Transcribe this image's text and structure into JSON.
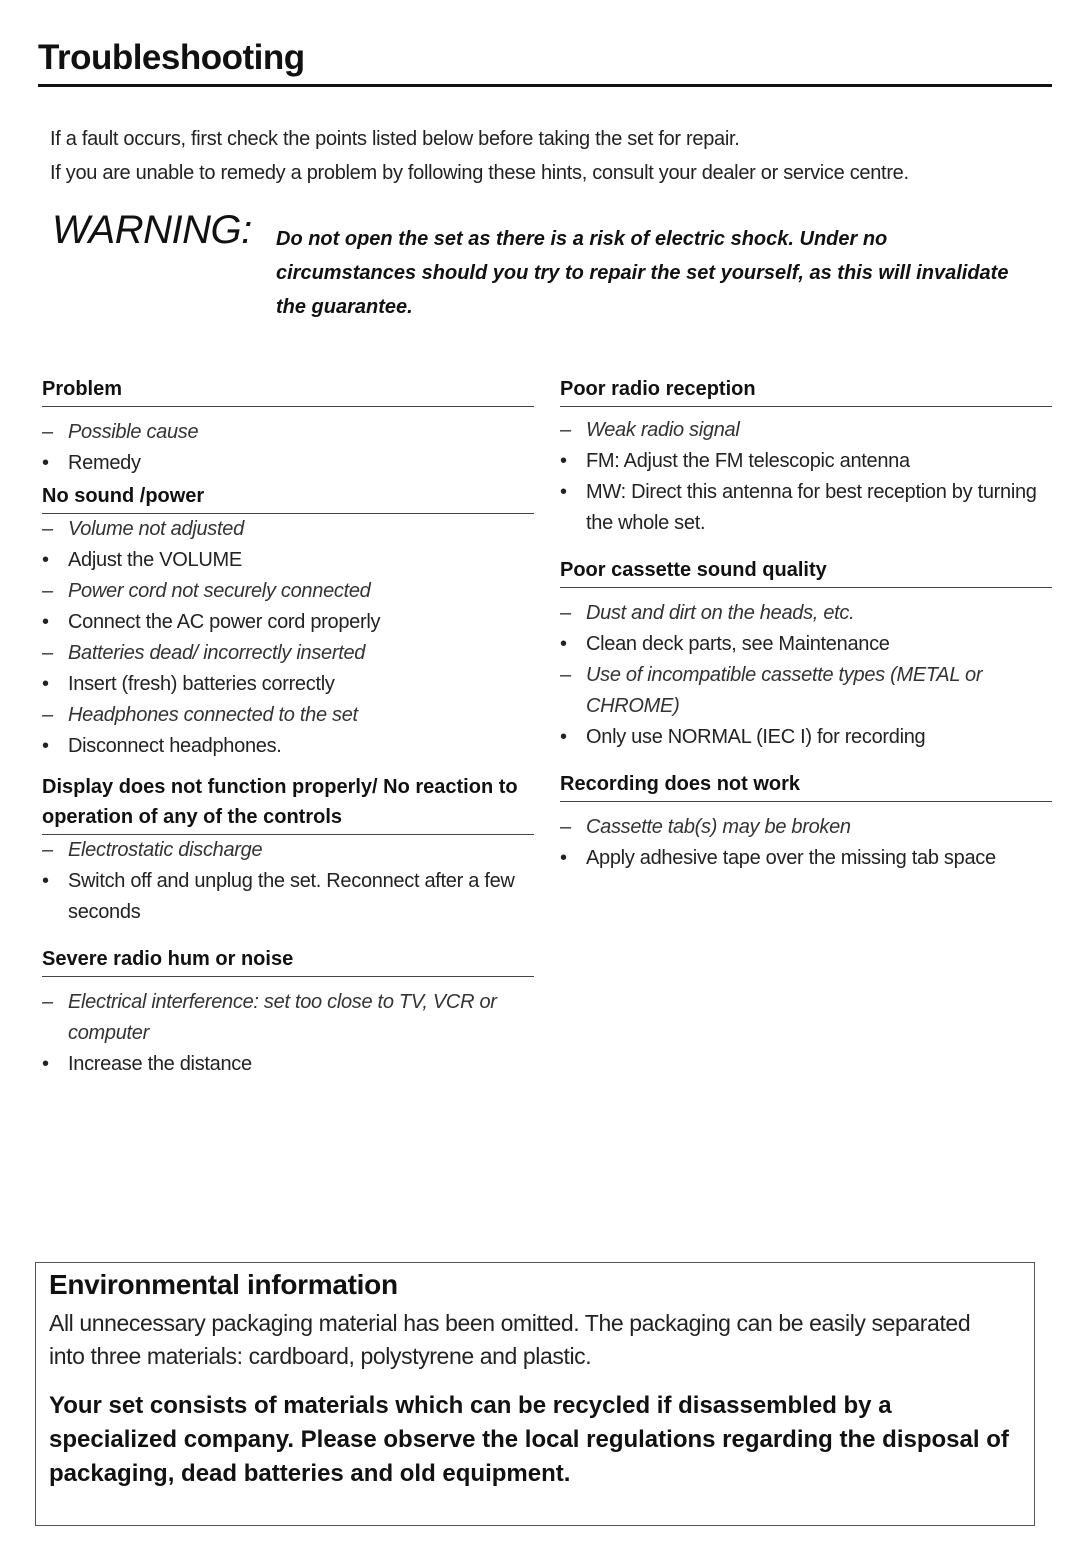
{
  "title": "Troubleshooting",
  "intro": [
    "If a fault occurs, first check the points listed below before taking the set for repair.",
    "If you are unable to remedy a problem by following these hints, consult your dealer or service centre."
  ],
  "warning": {
    "label": "WARNING:",
    "text": "Do not open the set as there is a risk of electric shock. Under no circumstances should you try to repair the set yourself, as this will invalidate the guarantee."
  },
  "icons": {
    "cause": "–",
    "remedy": "•"
  },
  "left_sections": [
    {
      "heading": "Problem",
      "items": [
        {
          "type": "cause",
          "text": "Possible cause"
        },
        {
          "type": "remedy",
          "text": "Remedy"
        }
      ]
    },
    {
      "heading": "No sound /power",
      "items": [
        {
          "type": "cause",
          "text": "Volume not adjusted"
        },
        {
          "type": "remedy",
          "text": "Adjust the VOLUME"
        },
        {
          "type": "cause",
          "text": "Power cord not securely connected"
        },
        {
          "type": "remedy",
          "text": "Connect the AC power cord properly"
        },
        {
          "type": "cause",
          "text": "Batteries dead/ incorrectly inserted"
        },
        {
          "type": "remedy",
          "text": "Insert (fresh) batteries correctly"
        },
        {
          "type": "cause",
          "text": "Headphones connected to the set"
        },
        {
          "type": "remedy",
          "text": "Disconnect headphones."
        }
      ]
    },
    {
      "heading": "Display does not function properly/ No reaction to operation of any of the controls",
      "items": [
        {
          "type": "cause",
          "text": "Electrostatic discharge"
        },
        {
          "type": "remedy",
          "text": "Switch off and unplug the set. Reconnect after a few seconds"
        }
      ]
    },
    {
      "heading": "Severe radio hum or noise",
      "items": [
        {
          "type": "cause",
          "text": "Electrical interference: set too close to TV, VCR or computer"
        },
        {
          "type": "remedy",
          "text": "Increase the distance"
        }
      ]
    }
  ],
  "right_sections": [
    {
      "heading": "Poor radio reception",
      "items": [
        {
          "type": "cause",
          "text": "Weak radio signal"
        },
        {
          "type": "remedy",
          "text": "FM: Adjust the FM telescopic antenna"
        },
        {
          "type": "remedy",
          "text": "MW: Direct this antenna for best reception by turning the whole set."
        }
      ]
    },
    {
      "heading": "Poor cassette sound quality",
      "items": [
        {
          "type": "cause",
          "text": "Dust and dirt on the heads, etc."
        },
        {
          "type": "remedy",
          "text": "Clean deck parts, see Maintenance"
        },
        {
          "type": "cause",
          "text": "Use of incompatible cassette types (METAL or CHROME)"
        },
        {
          "type": "remedy",
          "text": "Only use NORMAL (IEC I) for recording"
        }
      ]
    },
    {
      "heading": "Recording does not work",
      "items": [
        {
          "type": "cause",
          "text": "Cassette tab(s) may be broken"
        },
        {
          "type": "remedy",
          "text": "Apply adhesive tape over the missing tab space"
        }
      ]
    }
  ],
  "environment": {
    "heading": "Environmental information",
    "body": "All unnecessary packaging material has been omitted. The packaging can be easily separated into three materials: cardboard, polystyrene and plastic.",
    "bold": "Your set consists of materials which can be recycled if disassembled by a specialized company. Please observe the local regulations regarding the disposal of packaging, dead batteries and old equipment."
  }
}
